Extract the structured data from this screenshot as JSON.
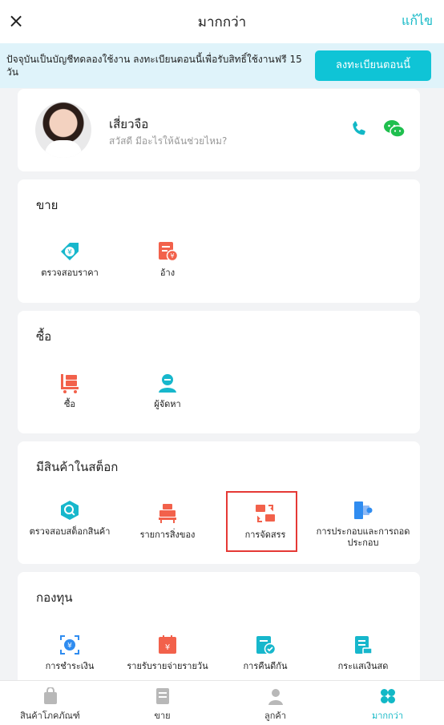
{
  "header": {
    "close_symbol": "×",
    "title": "มากกว่า",
    "edit_label": "แก้ไข"
  },
  "banner": {
    "message": "ปัจจุบันเป็นบัญชีทดลองใช้งาน ลงทะเบียนตอนนี้เพื่อรับสิทธิ์ใช้งานฟรี 15 วัน",
    "button_label": "ลงทะเบียนตอนนี้"
  },
  "contact": {
    "name": "เสี่ยวจือ",
    "greeting": "สวัสดี มีอะไรให้ฉันช่วยไหม?",
    "icons": [
      "phone-icon",
      "wechat-icon"
    ]
  },
  "sections": {
    "sell": {
      "title": "ขาย",
      "items": [
        {
          "label": "ตรวจสอบราคา",
          "icon": "price-tag-icon"
        },
        {
          "label": "อ้าง",
          "icon": "quote-icon"
        }
      ]
    },
    "buy": {
      "title": "ซื้อ",
      "items": [
        {
          "label": "ซื้อ",
          "icon": "cart-icon"
        },
        {
          "label": "ผู้จัดหา",
          "icon": "supplier-icon"
        }
      ]
    },
    "stock": {
      "title": "มีสินค้าในสต็อก",
      "items": [
        {
          "label": "ตรวจสอบสต็อกสินค้า",
          "icon": "stock-search-icon"
        },
        {
          "label": "รายการสิ่งของ",
          "icon": "inventory-list-icon"
        },
        {
          "label": "การจัดสรร",
          "icon": "allocation-icon"
        },
        {
          "label": "การประกอบและการถอดประกอบ",
          "icon": "assembly-icon"
        }
      ]
    },
    "fund": {
      "title": "กองทุน",
      "items": [
        {
          "label": "การชำระเงิน",
          "icon": "payment-icon"
        },
        {
          "label": "รายรับรายจ่ายรายวัน",
          "icon": "daily-ledger-icon"
        },
        {
          "label": "การคืนดีกัน",
          "icon": "reconcile-icon"
        },
        {
          "label": "กระแสเงินสด",
          "icon": "cash-flow-icon"
        }
      ]
    }
  },
  "tabbar": {
    "tabs": [
      {
        "label": "สินค้าโภคภัณฑ์",
        "icon": "bag-icon"
      },
      {
        "label": "ขาย",
        "icon": "document-icon"
      },
      {
        "label": "ลูกค้า",
        "icon": "person-icon"
      },
      {
        "label": "มากกว่า",
        "icon": "clover-icon",
        "active": true
      }
    ]
  },
  "colors": {
    "accent": "#12b8c6",
    "banner_bg": "#dff3fa",
    "register_button": "#0fc4d6",
    "icon_red": "#f2614b",
    "icon_teal": "#17b7cc",
    "icon_blue": "#2f8cf0",
    "highlight_border": "#e53935"
  }
}
